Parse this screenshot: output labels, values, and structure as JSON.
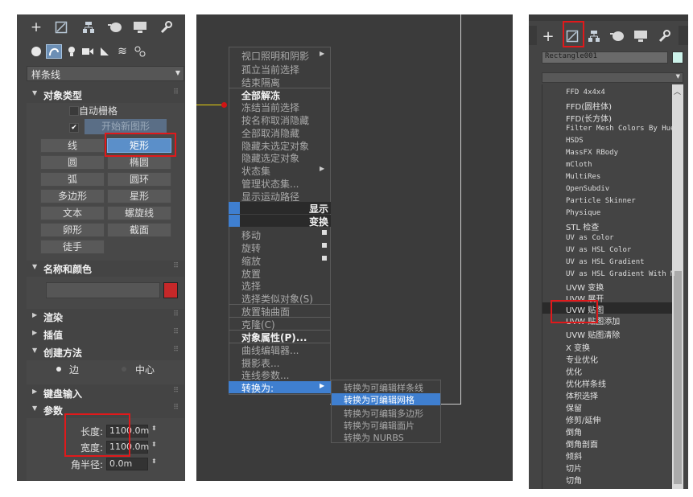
{
  "left_panel": {
    "top_tabs": [
      "plus-icon",
      "modify-icon",
      "hierarchy-icon",
      "motion-icon",
      "display-icon",
      "utilities-icon"
    ],
    "sub_tabs": [
      "geometry-icon",
      "shapes-icon",
      "lights-icon",
      "cameras-icon",
      "helpers-icon",
      "spacewarps-icon",
      "systems-icon"
    ],
    "category_dropdown": "样条线",
    "object_type": {
      "title": "对象类型",
      "autogrid_label": "自动栅格",
      "start_new_shape_label": "开始新图形",
      "buttons": [
        "线",
        "矩形",
        "圆",
        "椭圆",
        "弧",
        "圆环",
        "多边形",
        "星形",
        "文本",
        "螺旋线",
        "卵形",
        "截面",
        "徒手"
      ],
      "selected": "矩形"
    },
    "name_color": {
      "title": "名称和颜色",
      "color": "#c62829"
    },
    "rollouts": [
      "渲染",
      "插值"
    ],
    "creation_method": {
      "title": "创建方法",
      "edge_label": "边",
      "center_label": "中心"
    },
    "keyboard_entry": {
      "title": "键盘输入"
    },
    "parameters": {
      "title": "参数",
      "length_label": "长度:",
      "length_value": "1100.0m",
      "width_label": "宽度:",
      "width_value": "1100.0m",
      "corner_label": "角半径:",
      "corner_value": "0.0m"
    }
  },
  "quad_menu": {
    "items_a": [
      "视口照明和阴影",
      "孤立当前选择",
      "结束隔离"
    ],
    "items_b": [
      "全部解冻",
      "冻结当前选择",
      "按名称取消隐藏",
      "全部取消隐藏",
      "隐藏未选定对象",
      "隐藏选定对象",
      "状态集",
      "管理状态集...",
      "显示运动路径"
    ],
    "header_display": "显示",
    "header_transform": "变换",
    "items_c": [
      "移动",
      "旋转",
      "缩放",
      "放置",
      "选择",
      "选择类似对象(S)",
      "放置轴曲面",
      "克隆(C)",
      "对象属性(P)...",
      "曲线编辑器...",
      "摄影表...",
      "连线参数..."
    ],
    "convert_to": "转换为:",
    "submenu": [
      "转换为可编辑样条线",
      "转换为可编辑网格",
      "转换为可编辑多边形",
      "转换为可编辑面片",
      "转换为 NURBS"
    ],
    "submenu_selected": "转换为可编辑网格"
  },
  "right_panel": {
    "object_name": "Rectangle001",
    "modifiers": [
      "FFD 4x4x4",
      "FFD(圆柱体)",
      "FFD(长方体)",
      "Filter Mesh Colors By Hue",
      "HSDS",
      "MassFX RBody",
      "mCloth",
      "MultiRes",
      "OpenSubdiv",
      "Particle Skinner",
      "Physique",
      "STL 检查",
      "UV as Color",
      "UV as HSL Color",
      "UV as HSL Gradient",
      "UV as HSL Gradient With M",
      "UVW 变换",
      "UVW 展开",
      "UVW 贴图",
      "UVW 贴图添加",
      "UVW 贴图清除",
      "X 变换",
      "专业优化",
      "优化",
      "优化样条线",
      "体积选择",
      "保留",
      "修剪/延伸",
      "倒角",
      "倒角剖面",
      "倾斜",
      "切片",
      "切角"
    ],
    "highlighted": "UVW 贴图"
  }
}
